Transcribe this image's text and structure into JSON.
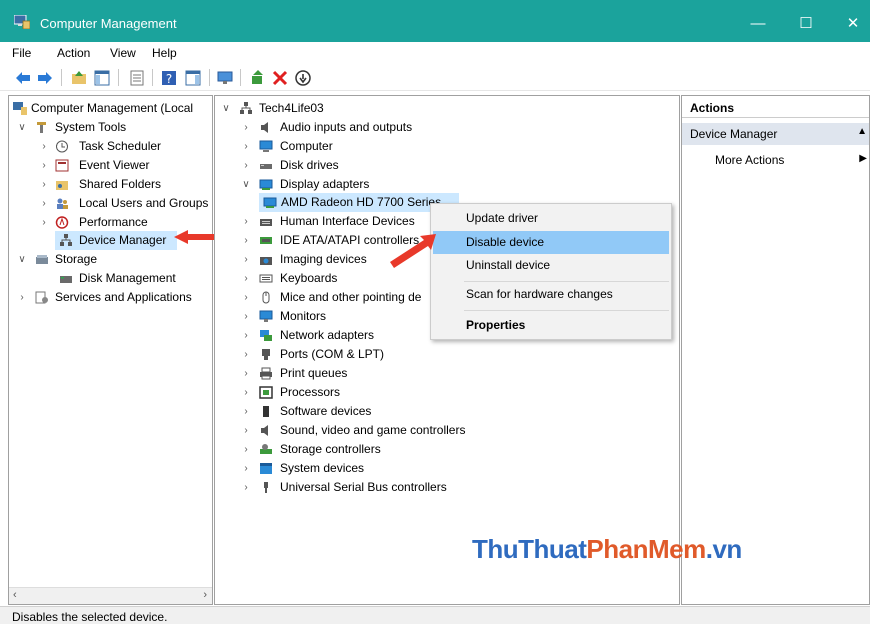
{
  "window": {
    "title": "Computer Management",
    "minimize": "—",
    "maximize": "☐",
    "close": "✕"
  },
  "menu": [
    "File",
    "Action",
    "View",
    "Help"
  ],
  "left_tree": {
    "root": "Computer Management (Local",
    "system_tools": "System Tools",
    "task_scheduler": "Task Scheduler",
    "event_viewer": "Event Viewer",
    "shared_folders": "Shared Folders",
    "local_users": "Local Users and Groups",
    "performance": "Performance",
    "device_manager": "Device Manager",
    "storage": "Storage",
    "disk_management": "Disk Management",
    "services": "Services and Applications"
  },
  "device_tree": {
    "computer_name": "Tech4Life03",
    "categories": [
      "Audio inputs and outputs",
      "Computer",
      "Disk drives",
      "Display adapters",
      "AMD Radeon HD 7700 Series",
      "Human Interface Devices",
      "IDE ATA/ATAPI controllers",
      "Imaging devices",
      "Keyboards",
      "Mice and other pointing de",
      "Monitors",
      "Network adapters",
      "Ports (COM & LPT)",
      "Print queues",
      "Processors",
      "Software devices",
      "Sound, video and game controllers",
      "Storage controllers",
      "System devices",
      "Universal Serial Bus controllers"
    ]
  },
  "actions": {
    "header": "Actions",
    "section": "Device Manager",
    "more": "More Actions"
  },
  "context_menu": {
    "update": "Update driver",
    "disable": "Disable device",
    "uninstall": "Uninstall device",
    "scan": "Scan for hardware changes",
    "properties": "Properties"
  },
  "status": "Disables the selected device.",
  "watermark": {
    "part1": "ThuThuat",
    "part2": "PhanMem",
    "part3": ".vn"
  },
  "colors": {
    "titlebar": "#1ba39c",
    "highlight": "#91c9f7",
    "selection": "#cce8ff",
    "arrow": "#e8392a"
  }
}
